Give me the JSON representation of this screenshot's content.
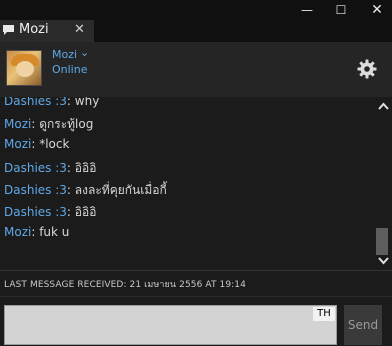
{
  "window": {
    "minimize_glyph": "—",
    "maximize_glyph": "☐",
    "close_glyph": "✕"
  },
  "tab": {
    "label": "Mozi",
    "close_glyph": "✕",
    "icon": "chat-bubble-icon"
  },
  "contact": {
    "name": "Mozi",
    "status": "Online",
    "chevron": "⌄",
    "avatar": "avatar-image",
    "settings_icon": "gear-icon"
  },
  "colors": {
    "accent": "#5fa8e6",
    "background": "#1b1b1b",
    "header": "#252525"
  },
  "messages": [
    {
      "author": "Dashies :3",
      "sep": ": ",
      "text": "why"
    },
    {
      "author": "Mozi",
      "sep": ": ",
      "text": "ดูกระทู้log"
    },
    {
      "author": "Mozi",
      "sep": ": ",
      "text": "*lock"
    },
    {
      "author": "Dashies :3",
      "sep": ": ",
      "text": "อิอิอิ"
    },
    {
      "author": "Dashies :3",
      "sep": ": ",
      "text": "ลงละที่คุยกันเมื่อกี้"
    },
    {
      "author": "Dashies :3",
      "sep": ": ",
      "text": "อิอิอิ"
    },
    {
      "author": "Mozi",
      "sep": ": ",
      "text": "fuk u"
    }
  ],
  "last_received": "LAST MESSAGE RECEIVED: 21 เมษายน 2556 AT 19:14",
  "composer": {
    "value": "",
    "input_language": "TH",
    "send_label": "Send"
  }
}
